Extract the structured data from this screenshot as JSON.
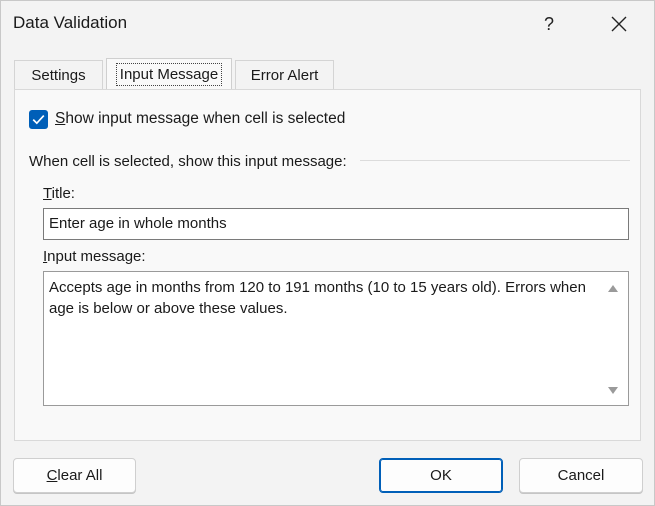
{
  "window": {
    "title": "Data Validation",
    "help_label": "?"
  },
  "tabs": [
    {
      "label": "Settings",
      "active": false
    },
    {
      "label": "Input Message",
      "active": true
    },
    {
      "label": "Error Alert",
      "active": false
    }
  ],
  "options": {
    "show_message_label_first": "S",
    "show_message_label_rest": "how input message when cell is selected",
    "show_message_checked": true,
    "group_label": "When cell is selected, show this input message:"
  },
  "title_field": {
    "label_first": "T",
    "label_rest": "itle:",
    "value": "Enter age in whole months"
  },
  "message_field": {
    "label_first": "I",
    "label_rest": "nput message:",
    "value": "Accepts age in months from 120 to 191 months (10 to 15 years old). Errors when age is below or above these values."
  },
  "buttons": {
    "clear_all_first": "C",
    "clear_all_rest": "lear All",
    "ok": "OK",
    "cancel": "Cancel"
  },
  "colors": {
    "accent": "#005fb8",
    "background": "#f3f3f3"
  }
}
